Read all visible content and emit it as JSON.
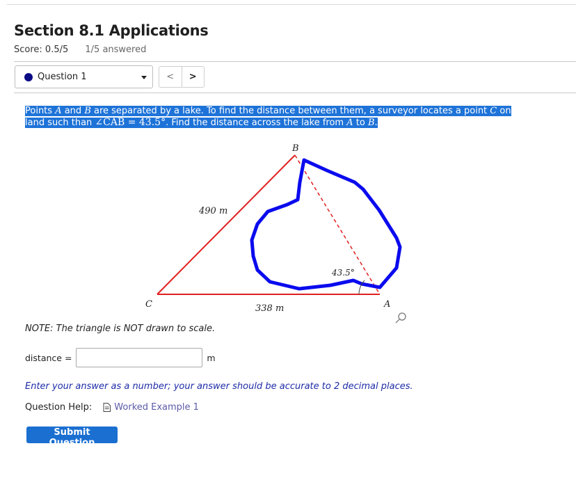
{
  "page": {
    "title": "Section 8.1 Applications"
  },
  "score": {
    "label": "Score: 0.5/5",
    "answered": "1/5 answered"
  },
  "question_nav": {
    "current": "Question 1",
    "prev": "<",
    "next": ">"
  },
  "prompt": {
    "part1": "Points ",
    "a": "A",
    "part2": " and ",
    "b": "B",
    "part3": " are separated by a lake. To find the distance between them, a surveyor locates a point ",
    "c": "C",
    "part4": " on land such than ",
    "angle": "∠CAB = 43.5°",
    "part5": ". Find the distance across the lake from ",
    "a2": "A",
    "part6": " to ",
    "b2": "B",
    "part7": "."
  },
  "figure": {
    "label_a": "A",
    "label_b": "B",
    "label_c": "C",
    "side_cb": "490 m",
    "side_ca": "338 m",
    "angle_a": "43.5°",
    "colors": {
      "triangle": "#e02020",
      "lake": "#0000ee",
      "hypotenuse_dash": "#e02020"
    }
  },
  "note": "NOTE: The triangle is NOT drawn to scale.",
  "answer": {
    "label": "distance =",
    "value": "",
    "placeholder": "",
    "unit": "m"
  },
  "hint": "Enter your answer as a number; your answer should be accurate to 2 decimal places.",
  "help": {
    "label": "Question Help:",
    "link": "Worked Example 1"
  },
  "submit_label": "Submit Question"
}
